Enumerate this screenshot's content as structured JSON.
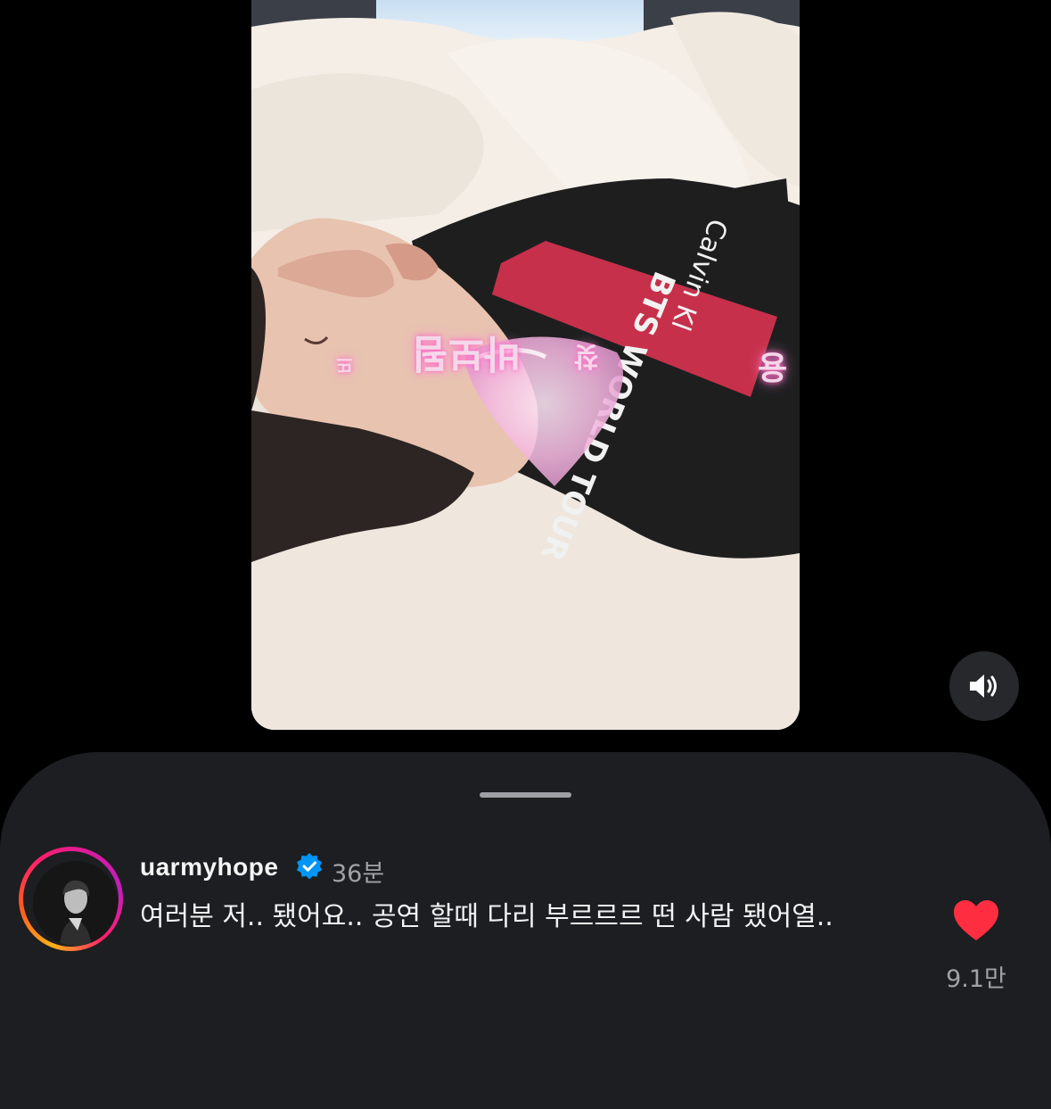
{
  "media": {
    "overlay_texts": [
      "바보됨",
      "찾",
      "용",
      "뜨"
    ]
  },
  "controls": {
    "sound_icon": "speaker-volume-icon"
  },
  "comment": {
    "username": "uarmyhope",
    "verified": true,
    "time": "36분",
    "text": "여러분 저.. 됐어요.. 공연 할때 다리 부르르르 떤 사람 됐어열..",
    "like_count": "9.1만",
    "liked": true,
    "like_icon": "heart-filled-icon"
  },
  "colors": {
    "background": "#000000",
    "sheet": "#1c1e21",
    "like": "#ff2d40",
    "verified": "#0095f6",
    "secondary_text": "#9ea3a8"
  }
}
